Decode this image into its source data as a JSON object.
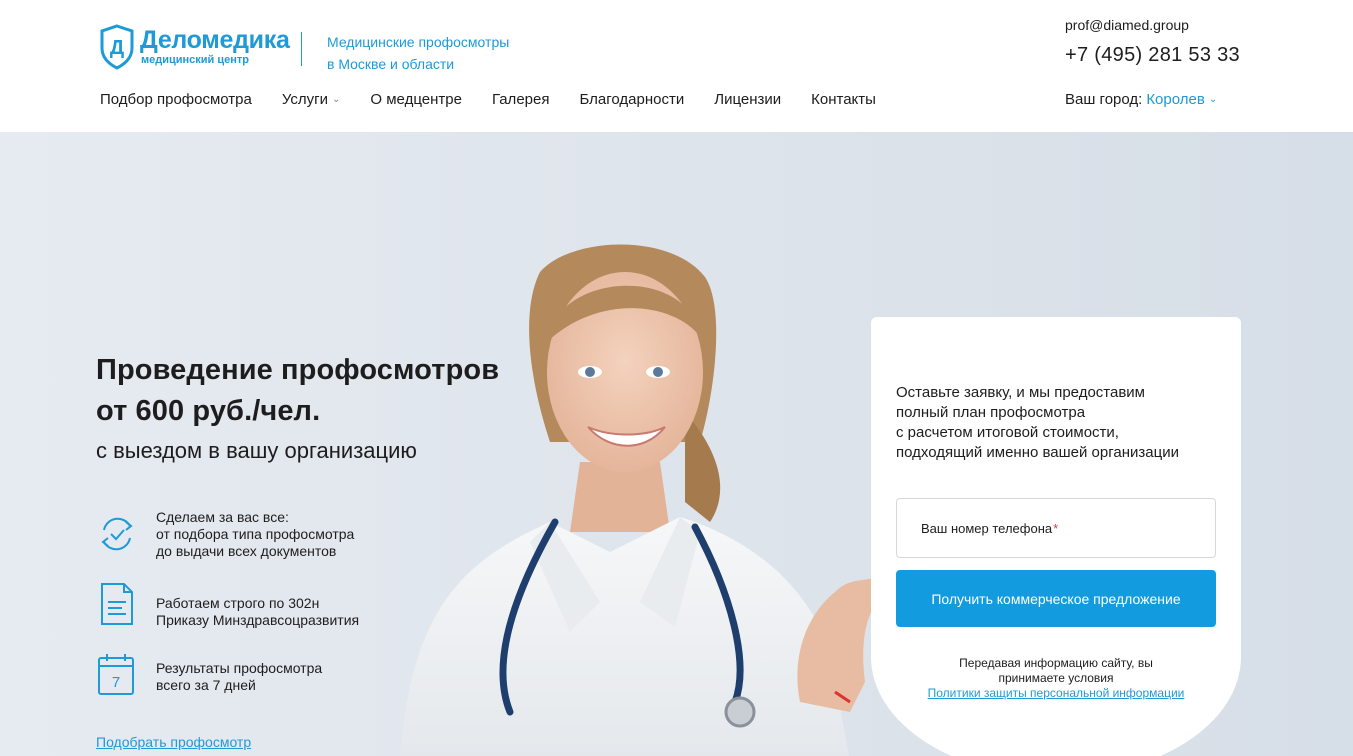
{
  "header": {
    "logo_name": "Деломедика",
    "logo_sub": "медицинский центр",
    "logo_letter": "Д",
    "tagline_line1": "Медицинские профосмотры",
    "tagline_line2": "в Москве и области",
    "email": "prof@diamed.group",
    "phone": "+7 (495) 281 53 33"
  },
  "nav": {
    "items": [
      {
        "label": "Подбор профосмотра"
      },
      {
        "label": "Услуги",
        "has_dropdown": true
      },
      {
        "label": "О медцентре"
      },
      {
        "label": "Галерея"
      },
      {
        "label": "Благодарности"
      },
      {
        "label": "Лицензии"
      },
      {
        "label": "Контакты"
      }
    ],
    "city_label": "Ваш город:",
    "city_value": "Королев"
  },
  "hero": {
    "title_line1": "Проведение профосмотров",
    "title_line2": "от 600 руб./чел.",
    "subtitle": "с выездом в вашу организацию",
    "features": [
      {
        "icon": "refresh-check-icon",
        "lines": [
          "Сделаем за вас все:",
          "от подбора типа профосмотра",
          "до выдачи всех документов"
        ]
      },
      {
        "icon": "document-icon",
        "lines": [
          "Работаем строго по 302н",
          "Приказу Минздравсоцразвития"
        ]
      },
      {
        "icon": "calendar-icon",
        "calendar_day": "7",
        "lines": [
          "Результаты профосмотра",
          "всего за 7 дней"
        ]
      }
    ],
    "link": "Подобрать профосмотр"
  },
  "form": {
    "intro_lines": [
      "Оставьте заявку, и мы предоставим",
      "полный план профосмотра",
      "с расчетом итоговой стоимости,",
      "подходящий именно вашей организации"
    ],
    "phone_placeholder": "Ваш номер телефона",
    "required_mark": "*",
    "submit_label": "Получить коммерческое предложение",
    "note_line1": "Передавая информацию сайту, вы",
    "note_line2": "принимаете условия",
    "note_link": "Политики защиты персональной информации"
  },
  "colors": {
    "brand": "#1e9ad6",
    "button": "#129cdf",
    "hero_bg": "#dfe5ec"
  }
}
